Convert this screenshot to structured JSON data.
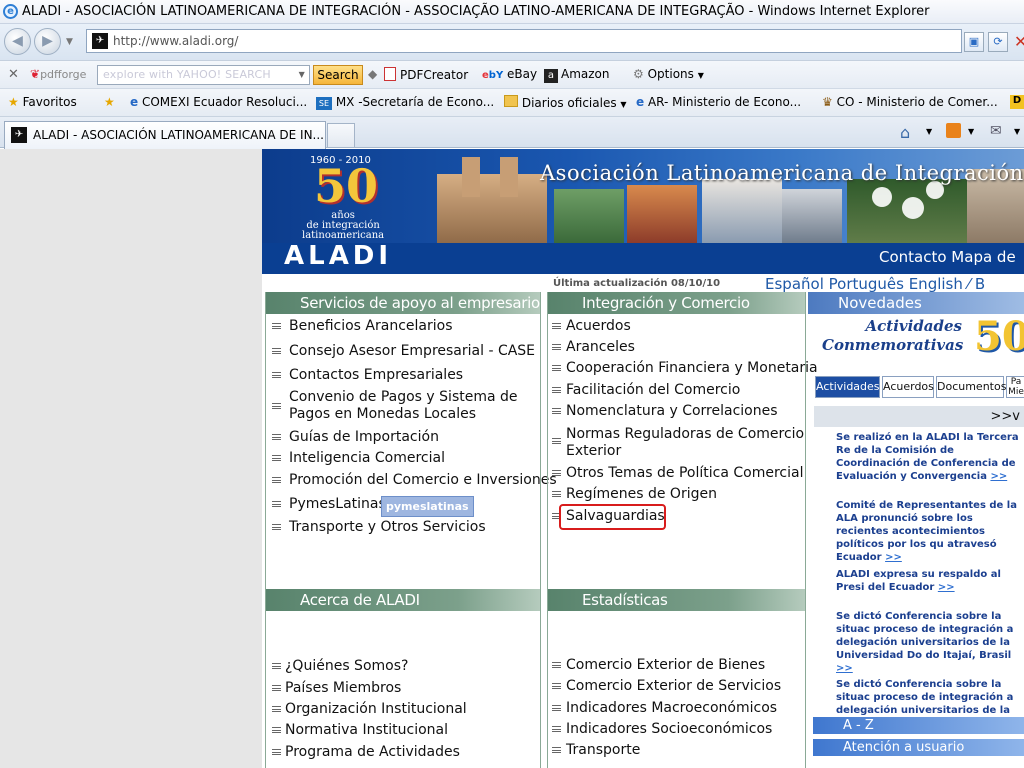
{
  "browser": {
    "window_title": "ALADI - ASOCIACIÓN LATINOAMERICANA DE INTEGRACIÓN - ASSOCIAÇÃO LATINO-AMERICANA DE INTEGRAÇÃO - Windows Internet Explorer",
    "url": "http://www.aladi.org/",
    "tab_title": "ALADI - ASOCIACIÓN LATINOAMERICANA DE IN..."
  },
  "toolbar": {
    "pdfforge": "pdfforge",
    "search_placeholder": "explore with YAHOO! SEARCH",
    "search_label": "Search",
    "pdfcreator": "PDFCreator",
    "ebay": "eBay",
    "amazon": "Amazon",
    "options": "Options"
  },
  "favorites": {
    "label": "Favoritos",
    "items": [
      "COMEXI Ecuador Resoluci...",
      "MX -Secretaría de Econo...",
      "Diarios oficiales",
      "AR- Ministerio de Econo...",
      "CO - Ministerio de Comer..."
    ]
  },
  "site": {
    "banner_title": "Asociación Latinoamericana de Integración",
    "years": "1960 - 2010",
    "fifty": "50",
    "aniv_line1": "años",
    "aniv_line2": "de integración",
    "aniv_line3": "latinoamericana",
    "logo": "ALADI",
    "top_links": "Contacto   Mapa de",
    "updated": "Última actualización 08/10/10",
    "languages": "Español    Português    English    ⁄ B"
  },
  "col1": {
    "header": "Servicios de apoyo al empresario",
    "items": [
      "Beneficios Arancelarios",
      "Consejo Asesor Empresarial - CASE",
      "Contactos Empresariales",
      "Convenio de Pagos y Sistema de",
      "Pagos en Monedas Locales",
      "Guías de Importación",
      "Inteligencia Comercial",
      "Promoción del Comercio e Inversiones",
      "PymesLatinas",
      "Transporte y Otros Servicios"
    ],
    "pymes_badge": "pymeslatinas",
    "header2": "Acerca de ALADI",
    "items2": [
      "¿Quiénes Somos?",
      "Países Miembros",
      "Organización Institucional",
      "Normativa Institucional",
      "Programa de Actividades"
    ]
  },
  "col2": {
    "header": "Integración y Comercio",
    "items": [
      "Acuerdos",
      "Aranceles",
      "Cooperación Financiera y Monetaria",
      "Facilitación del Comercio",
      "Nomenclatura y Correlaciones",
      "Normas Reguladoras de Comercio",
      "Exterior",
      "Otros Temas de Política Comercial",
      "Regímenes de Origen",
      "Salvaguardias"
    ],
    "header2": "Estadísticas",
    "items2": [
      "Comercio Exterior de Bienes",
      "Comercio Exterior de Servicios",
      "Indicadores Macroeconómicos",
      "Indicadores Socioeconómicos",
      "Transporte"
    ]
  },
  "col3": {
    "header": "Novedades",
    "act_line1": "Actividades",
    "act_line2": "Conmemorativas",
    "act_50": "50",
    "tabs": [
      "Actividades",
      "Acuerdos",
      "Documentos",
      "Pa Mie"
    ],
    "more": ">>v",
    "news": [
      "Se realizó en la ALADI la Tercera Re de la Comisión de Coordinación de Conferencia de Evaluación y Convergencia",
      "Comité de Representantes de la ALA pronunció sobre los recientes acontecimientos políticos por los qu atravesó Ecuador",
      "ALADI expresa su respaldo al Presi del Ecuador",
      "Se dictó Conferencia sobre la situac proceso de integración a delegación universitarios de la Universidad Do do Itajaí, Brasil",
      "Se dictó Conferencia sobre la situac proceso de integración a delegación universitarios de la Universidad"
    ],
    "news_link": ">>",
    "az": "A - Z",
    "atencion": "Atención a usuario"
  }
}
